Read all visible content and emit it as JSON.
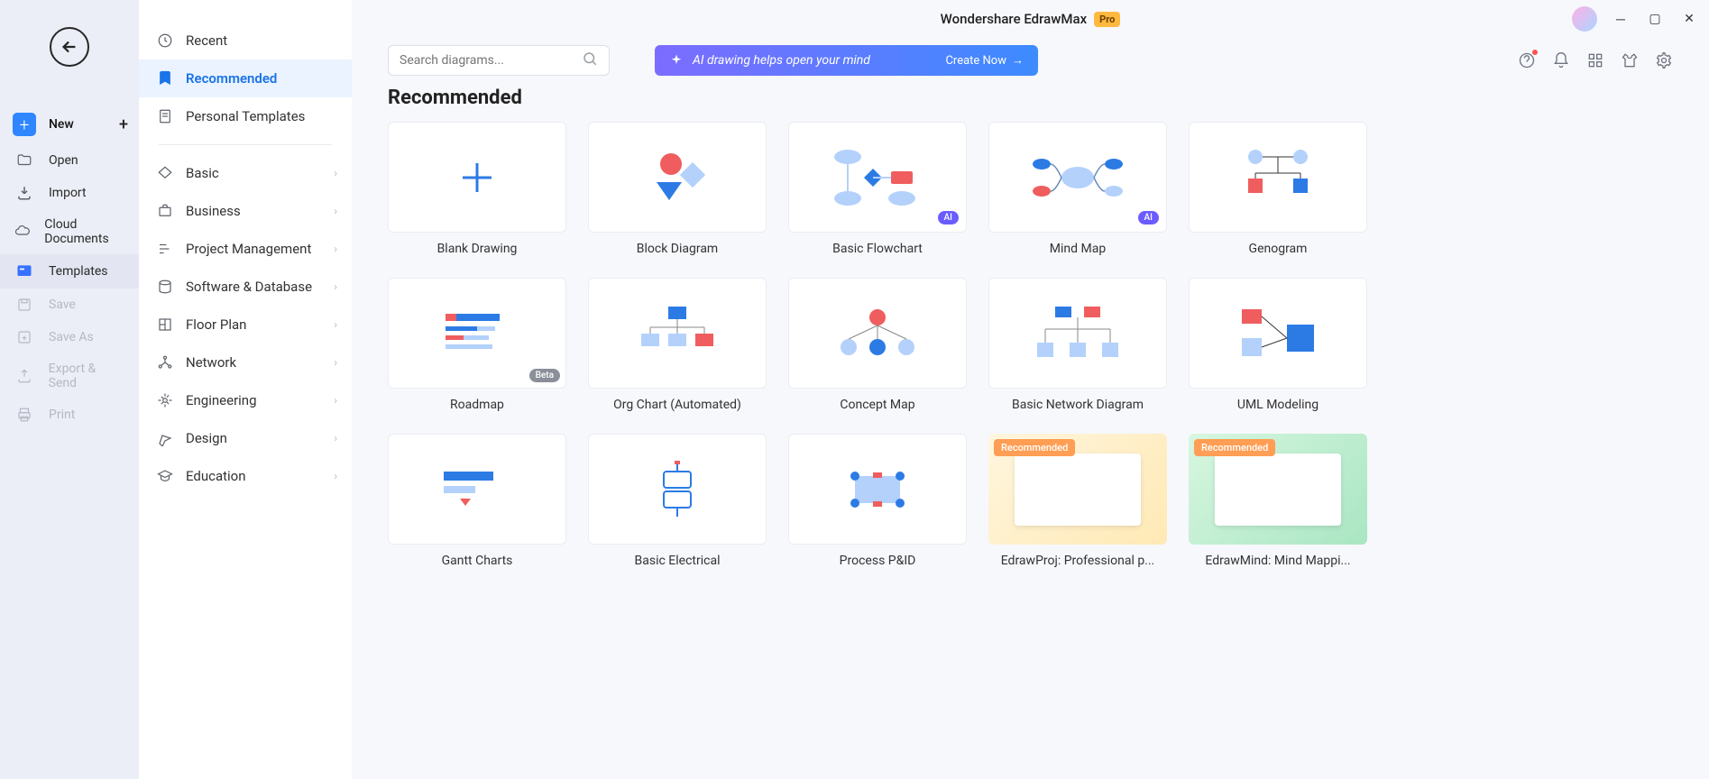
{
  "app": {
    "title": "Wondershare EdrawMax",
    "pro_label": "Pro"
  },
  "left_menu": {
    "new": "New",
    "open": "Open",
    "import": "Import",
    "cloud": "Cloud Documents",
    "templates": "Templates",
    "save": "Save",
    "save_as": "Save As",
    "export": "Export & Send",
    "print": "Print"
  },
  "mid_menu": {
    "recent": "Recent",
    "recommended": "Recommended",
    "personal": "Personal Templates",
    "basic": "Basic",
    "business": "Business",
    "project": "Project Management",
    "software": "Software & Database",
    "floor": "Floor Plan",
    "network": "Network",
    "engineering": "Engineering",
    "design": "Design",
    "education": "Education"
  },
  "search": {
    "placeholder": "Search diagrams..."
  },
  "ai_banner": {
    "text": "AI drawing helps open your mind",
    "cta": "Create Now"
  },
  "section": {
    "title": "Recommended"
  },
  "badges": {
    "ai": "AI",
    "beta": "Beta",
    "recommended": "Recommended"
  },
  "templates": [
    {
      "label": "Blank Drawing"
    },
    {
      "label": "Block Diagram"
    },
    {
      "label": "Basic Flowchart",
      "ai": true
    },
    {
      "label": "Mind Map",
      "ai": true
    },
    {
      "label": "Genogram"
    },
    {
      "label": "Roadmap",
      "beta": true
    },
    {
      "label": "Org Chart (Automated)"
    },
    {
      "label": "Concept Map"
    },
    {
      "label": "Basic Network Diagram"
    },
    {
      "label": "UML Modeling"
    },
    {
      "label": "Gantt Charts"
    },
    {
      "label": "Basic Electrical"
    },
    {
      "label": "Process P&ID"
    },
    {
      "label": "EdrawProj: Professional p...",
      "recommended": true,
      "special": 1
    },
    {
      "label": "EdrawMind: Mind Mappi...",
      "recommended": true,
      "special": 2
    }
  ]
}
